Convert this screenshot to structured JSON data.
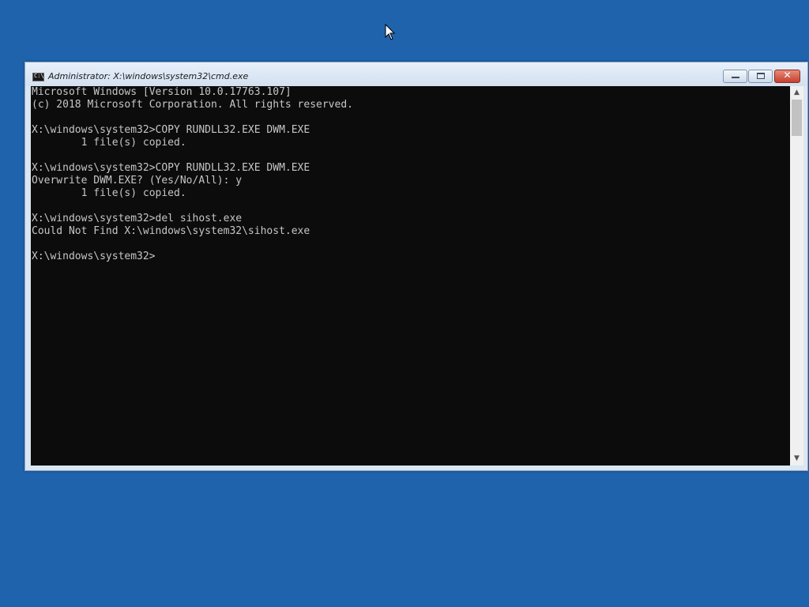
{
  "window": {
    "title": "Administrator: X:\\windows\\system32\\cmd.exe",
    "icon_text": "C:\\",
    "buttons": {
      "minimize": "minimize",
      "maximize": "maximize",
      "close": "✕"
    }
  },
  "console": {
    "lines": [
      "Microsoft Windows [Version 10.0.17763.107]",
      "(c) 2018 Microsoft Corporation. All rights reserved.",
      "",
      "X:\\windows\\system32>COPY RUNDLL32.EXE DWM.EXE",
      "        1 file(s) copied.",
      "",
      "X:\\windows\\system32>COPY RUNDLL32.EXE DWM.EXE",
      "Overwrite DWM.EXE? (Yes/No/All): y",
      "        1 file(s) copied.",
      "",
      "X:\\windows\\system32>del sihost.exe",
      "Could Not Find X:\\windows\\system32\\sihost.exe",
      "",
      "X:\\windows\\system32>"
    ],
    "colors": {
      "background": "#0c0c0c",
      "text": "#c6c6c6"
    }
  },
  "scrollbar": {
    "up": "▲",
    "down": "▼"
  },
  "desktop": {
    "background": "#1f63ad"
  }
}
